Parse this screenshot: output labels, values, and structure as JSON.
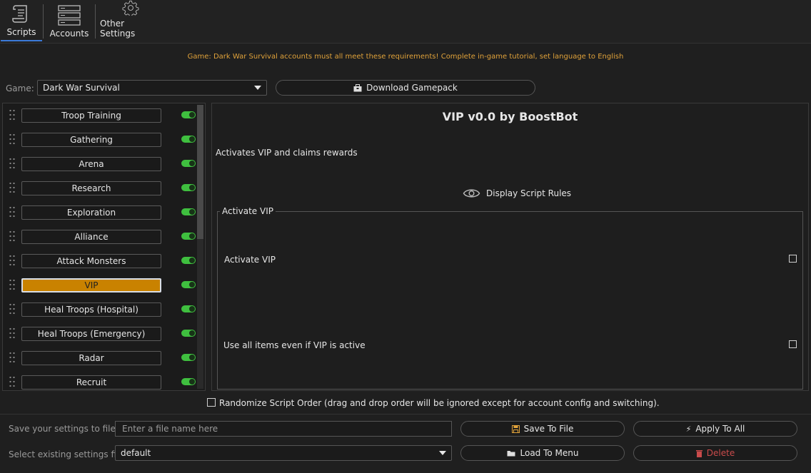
{
  "tabs": [
    {
      "label": "Scripts",
      "icon": "scroll-icon",
      "active": true
    },
    {
      "label": "Accounts",
      "icon": "server-icon",
      "active": false
    },
    {
      "label": "Other Settings",
      "icon": "gear-icon",
      "active": false
    }
  ],
  "notice": "Game: Dark War Survival accounts must all meet these requirements! Complete in-game tutorial, set language to English",
  "game": {
    "label": "Game:",
    "selected": "Dark War Survival"
  },
  "download_button": "Download Gamepack",
  "scripts": [
    {
      "label": "Troop Training",
      "enabled": true,
      "active": false
    },
    {
      "label": "Gathering",
      "enabled": true,
      "active": false
    },
    {
      "label": "Arena",
      "enabled": true,
      "active": false
    },
    {
      "label": "Research",
      "enabled": true,
      "active": false
    },
    {
      "label": "Exploration",
      "enabled": true,
      "active": false
    },
    {
      "label": "Alliance",
      "enabled": true,
      "active": false
    },
    {
      "label": "Attack Monsters",
      "enabled": true,
      "active": false
    },
    {
      "label": "VIP",
      "enabled": true,
      "active": true
    },
    {
      "label": "Heal Troops (Hospital)",
      "enabled": true,
      "active": false
    },
    {
      "label": "Heal Troops (Emergency)",
      "enabled": true,
      "active": false
    },
    {
      "label": "Radar",
      "enabled": true,
      "active": false
    },
    {
      "label": "Recruit",
      "enabled": true,
      "active": false
    }
  ],
  "detail": {
    "title": "VIP v0.0 by BoostBot",
    "description": "Activates VIP and claims rewards",
    "rules_button": "Display Script Rules",
    "group_title": "Activate VIP",
    "options": [
      {
        "label": "Activate VIP",
        "checked": false
      },
      {
        "label": "Use all items even if VIP is active",
        "checked": false
      }
    ]
  },
  "randomize": {
    "label": "Randomize Script Order (drag and drop order will be ignored except for account config and switching).",
    "checked": false
  },
  "save": {
    "label": "Save your settings to file",
    "placeholder": "Enter a file name here",
    "value": "",
    "button": "Save To File"
  },
  "apply_button": "Apply To All",
  "load": {
    "label": "Select existing settings file",
    "selected": "default",
    "button": "Load To Menu"
  },
  "delete_button": "Delete",
  "colors": {
    "accent": "#c98200",
    "toggle_on": "#3fbf3f",
    "notice": "#e0a23a",
    "tab_underline": "#3b7ad8",
    "delete": "#c94b4b"
  }
}
